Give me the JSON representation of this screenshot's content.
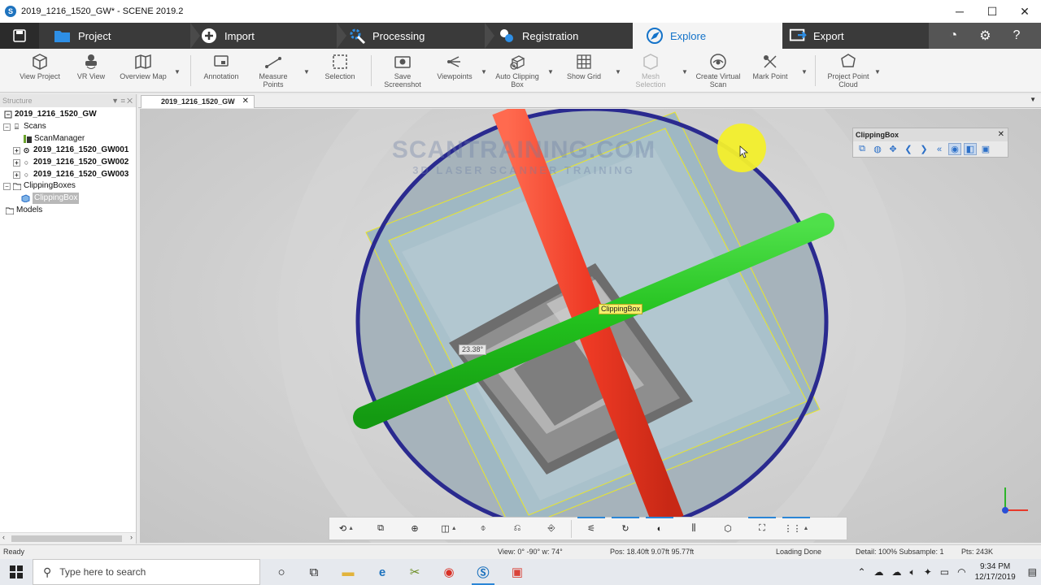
{
  "window": {
    "title": "2019_1216_1520_GW* - SCENE 2019.2",
    "buttons": {
      "minimize": "─",
      "maximize": "☐",
      "close": "✕"
    }
  },
  "workflow": {
    "tabs": [
      "Project",
      "Import",
      "Processing",
      "Registration",
      "Explore",
      "Export"
    ],
    "active_tab": "Explore",
    "accent_color": "#1473c9"
  },
  "ribbon": {
    "items": [
      "View Project",
      "VR View",
      "Overview Map",
      "Annotation",
      "Measure Points",
      "Selection",
      "Save Screenshot",
      "Viewpoints",
      "Auto Clipping Box",
      "Show Grid",
      "Mesh Selection",
      "Create Virtual Scan",
      "Mark Point",
      "Project Point Cloud"
    ]
  },
  "structure": {
    "header": "Structure",
    "controls": "▼ ⌗ ✕",
    "root": "2019_1216_1520_GW",
    "scans_label": "Scans",
    "scan_manager": "ScanManager",
    "scans": [
      "2019_1216_1520_GW001",
      "2019_1216_1520_GW002",
      "2019_1216_1520_GW003"
    ],
    "clipping_boxes_label": "ClippingBoxes",
    "clipping_box": "ClippingBox",
    "models_label": "Models"
  },
  "document_tab": {
    "label": "2019_1216_1520_GW",
    "close": "✕"
  },
  "viewport": {
    "watermark_line1": "SCANTRAINING.COM",
    "watermark_line2": "3D LASER SCANNER TRAINING",
    "object_label": "ClippingBox",
    "angle_label": "23.38°",
    "colors": {
      "x_axis": "#ee3a25",
      "y_axis": "#22c01d",
      "ring": "#2a2a8f",
      "box": "#e9e62a"
    }
  },
  "clipping_panel": {
    "title": "ClippingBox",
    "close": "✕"
  },
  "status": {
    "ready": "Ready",
    "view": "View: 0° -90° w: 74°",
    "pos": "Pos: 18.40ft 9.07ft 95.77ft",
    "loading": "Loading Done",
    "detail": "Detail: 100%  Subsample:  1",
    "pts": "Pts: 243K"
  },
  "taskbar": {
    "search_placeholder": "Type here to search",
    "time": "9:34 PM",
    "date": "12/17/2019"
  }
}
